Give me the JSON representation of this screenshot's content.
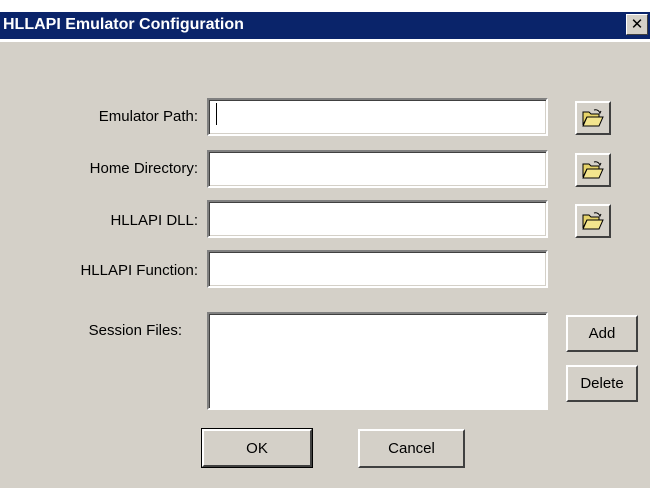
{
  "window": {
    "title": "HLLAPI Emulator Configuration",
    "close_glyph": "✕"
  },
  "form": {
    "emulator_path": {
      "label": "Emulator Path:",
      "value": ""
    },
    "home_directory": {
      "label": "Home Directory:",
      "value": ""
    },
    "hllapi_dll": {
      "label": "HLLAPI DLL:",
      "value": ""
    },
    "hllapi_function": {
      "label": "HLLAPI Function:",
      "value": ""
    },
    "session_files": {
      "label": "Session Files:",
      "items": []
    }
  },
  "buttons": {
    "add": "Add",
    "delete": "Delete",
    "ok": "OK",
    "cancel": "Cancel"
  },
  "icons": {
    "browse": "open-folder-icon"
  },
  "colors": {
    "dialog_bg": "#d4d0c8",
    "title_bar": "#0a246a",
    "folder_icon": "#e6d36a"
  }
}
